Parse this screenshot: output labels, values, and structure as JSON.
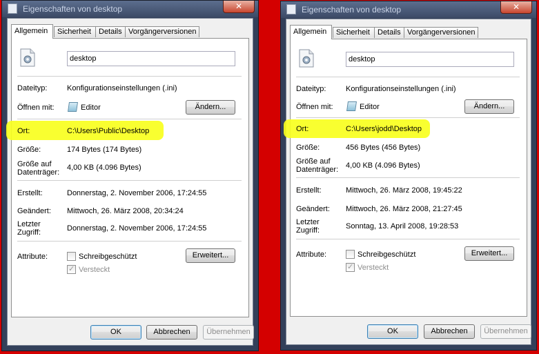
{
  "dialogs": [
    {
      "title": "Eigenschaften von desktop",
      "close_label": "✕",
      "tabs": [
        "Allgemein",
        "Sicherheit",
        "Details",
        "Vorgängerversionen"
      ],
      "filename": "desktop",
      "labels": {
        "type": "Dateityp:",
        "opens_with": "Öffnen mit:",
        "location": "Ort:",
        "size": "Größe:",
        "size_on_disk_1": "Größe auf",
        "size_on_disk_2": "Datenträger:",
        "created": "Erstellt:",
        "modified": "Geändert:",
        "accessed_1": "Letzter",
        "accessed_2": "Zugriff:",
        "attributes": "Attribute:"
      },
      "values": {
        "type": "Konfigurationseinstellungen (.ini)",
        "opens_with": "Editor",
        "location": "C:\\Users\\Public\\Desktop",
        "size": "174 Bytes (174 Bytes)",
        "size_on_disk": "4,00 KB (4.096 Bytes)",
        "created": "Donnerstag, 2. November 2006, 17:24:55",
        "modified": "Mittwoch, 26. März 2008, 20:34:24",
        "accessed": "Donnerstag, 2. November 2006, 17:24:55"
      },
      "checkboxes": {
        "readonly": {
          "label": "Schreibgeschützt",
          "checked": false
        },
        "hidden": {
          "label": "Versteckt",
          "checked": true
        }
      },
      "buttons": {
        "change": "Ändern...",
        "advanced": "Erweitert...",
        "ok": "OK",
        "cancel": "Abbrechen",
        "apply": "Übernehmen"
      }
    },
    {
      "title": "Eigenschaften von desktop",
      "close_label": "✕",
      "tabs": [
        "Allgemein",
        "Sicherheit",
        "Details",
        "Vorgängerversionen"
      ],
      "filename": "desktop",
      "labels": {
        "type": "Dateityp:",
        "opens_with": "Öffnen mit:",
        "location": "Ort:",
        "size": "Größe:",
        "size_on_disk_1": "Größe auf",
        "size_on_disk_2": "Datenträger:",
        "created": "Erstellt:",
        "modified": "Geändert:",
        "accessed_1": "Letzter",
        "accessed_2": "Zugriff:",
        "attributes": "Attribute:"
      },
      "values": {
        "type": "Konfigurationseinstellungen (.ini)",
        "opens_with": "Editor",
        "location": "C:\\Users\\jodd\\Desktop",
        "size": "456 Bytes (456 Bytes)",
        "size_on_disk": "4,00 KB (4.096 Bytes)",
        "created": "Mittwoch, 26. März 2008, 19:45:22",
        "modified": "Mittwoch, 26. März 2008, 21:27:45",
        "accessed": "Sonntag, 13. April 2008, 19:28:53"
      },
      "checkboxes": {
        "readonly": {
          "label": "Schreibgeschützt",
          "checked": false
        },
        "hidden": {
          "label": "Versteckt",
          "checked": true
        }
      },
      "buttons": {
        "change": "Ändern...",
        "advanced": "Erweitert...",
        "ok": "OK",
        "cancel": "Abbrechen",
        "apply": "Übernehmen"
      }
    }
  ],
  "colors": {
    "highlight": "#f8ff1e",
    "background": "#d40000"
  }
}
